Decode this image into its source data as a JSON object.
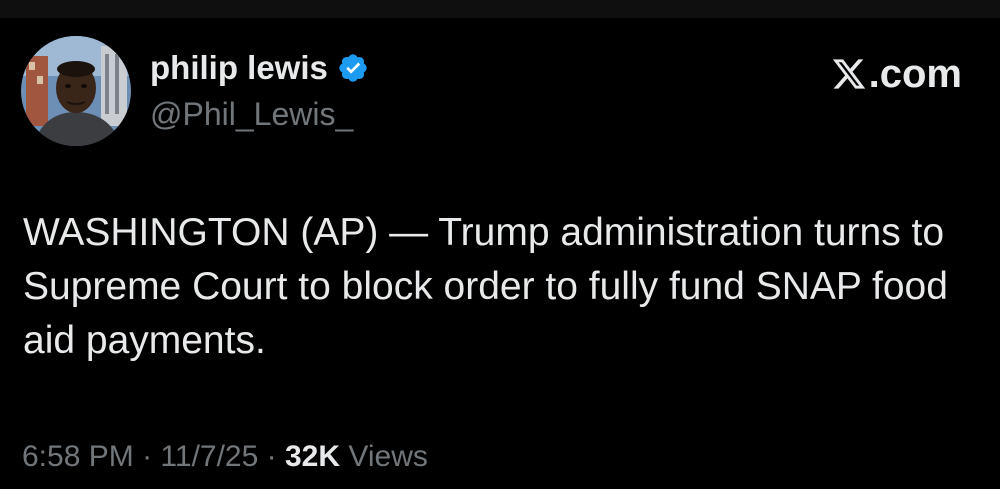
{
  "author": {
    "display_name": "philip lewis",
    "handle": "@Phil_Lewis_",
    "verified": true
  },
  "brand": {
    "text": ".com",
    "icon": "x-logo-icon"
  },
  "tweet": {
    "text": "WASHINGTON (AP) — Trump administration turns to Supreme Court to block order to fully fund SNAP food aid payments."
  },
  "meta": {
    "time": "6:58 PM",
    "separator": "·",
    "date": "11/7/25",
    "views_count": "32K",
    "views_label": "Views"
  },
  "colors": {
    "background": "#000000",
    "primary_text": "#e7e9ea",
    "secondary_text": "#71767b",
    "verified_blue": "#1d9bf0"
  }
}
